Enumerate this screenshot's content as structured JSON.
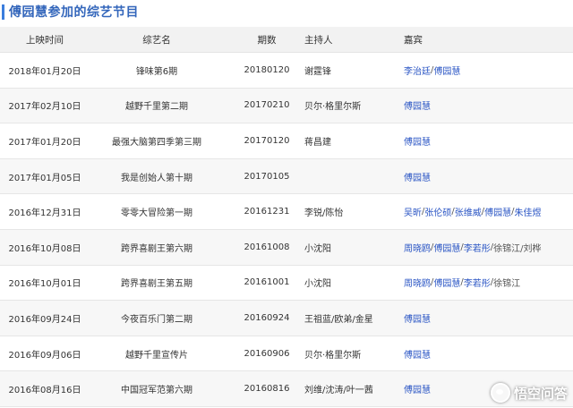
{
  "page_title": "傅园慧参加的综艺节目",
  "headers": {
    "date": "上映时间",
    "show": "综艺名",
    "episode": "期数",
    "host": "主持人",
    "guests": "嘉宾"
  },
  "rows": [
    {
      "date": "2018年01月20日",
      "show": "锋味第6期",
      "episode": "20180120",
      "host": "谢霆锋",
      "guests": [
        "李治廷",
        "傅园慧"
      ]
    },
    {
      "date": "2017年02月10日",
      "show": "越野千里第二期",
      "episode": "20170210",
      "host": "贝尔·格里尔斯",
      "guests": [
        "傅园慧"
      ]
    },
    {
      "date": "2017年01月20日",
      "show": "最强大脑第四季第三期",
      "episode": "20170120",
      "host": "蒋昌建",
      "guests": [
        "傅园慧"
      ]
    },
    {
      "date": "2017年01月05日",
      "show": "我是创始人第十期",
      "episode": "20170105",
      "host": "",
      "guests": [
        "傅园慧"
      ]
    },
    {
      "date": "2016年12月31日",
      "show": "零零大冒险第一期",
      "episode": "20161231",
      "host": "李锐/陈怡",
      "guests": [
        "吴昕",
        "张伦硕",
        "张维威",
        "傅园慧",
        "朱佳煜"
      ]
    },
    {
      "date": "2016年10月08日",
      "show": "跨界喜剧王第六期",
      "episode": "20161008",
      "host": "小沈阳",
      "guests": [
        "周晓鸥",
        "傅园慧",
        "李若彤"
      ],
      "guests_plain": "徐锦江/刘桦"
    },
    {
      "date": "2016年10月01日",
      "show": "跨界喜剧王第五期",
      "episode": "20161001",
      "host": "小沈阳",
      "guests": [
        "周晓鸥",
        "傅园慧",
        "李若彤"
      ],
      "guests_plain": "徐锦江"
    },
    {
      "date": "2016年09月24日",
      "show": "今夜百乐门第二期",
      "episode": "20160924",
      "host": "王祖蓝/欧弟/金星",
      "guests": [
        "傅园慧"
      ]
    },
    {
      "date": "2016年09月06日",
      "show": "越野千里宣传片",
      "episode": "20160906",
      "host": "贝尔·格里尔斯",
      "guests": [
        "傅园慧"
      ]
    },
    {
      "date": "2016年08月16日",
      "show": "中国冠军范第六期",
      "episode": "20160816",
      "host": "刘维/沈涛/叶一茜",
      "guests": [
        "傅园慧"
      ]
    }
  ],
  "watermark": "悟空问答",
  "colors": {
    "accent": "#3b7ddd",
    "title": "#3366bb",
    "link": "#2a55c4",
    "header_bg": "#f2f2f2",
    "alt_row_bg": "#f7f7f7"
  }
}
